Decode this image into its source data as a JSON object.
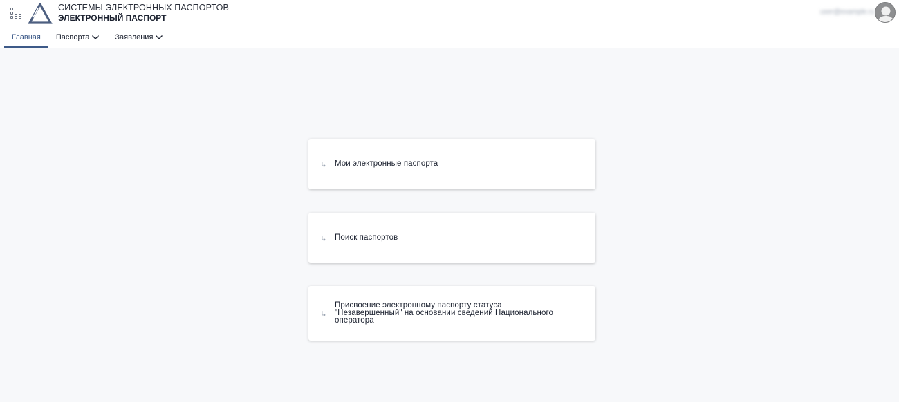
{
  "header": {
    "brand_line1": "СИСТЕМЫ ЭЛЕКТРОННЫХ ПАСПОРТОВ",
    "brand_line2": "ЭЛЕКТРОННЫЙ ПАСПОРТ",
    "apps_icon": "grid-icon",
    "logo_icon": "triangle-logo",
    "user_name": "user@example.ru",
    "colors": {
      "accent": "#3d5a88",
      "logo": "#4d5f80"
    }
  },
  "nav": {
    "items": [
      {
        "label": "Главная",
        "active": true
      },
      {
        "label": "Паспорта",
        "dropdown": true
      },
      {
        "label": "Заявления",
        "dropdown": true
      }
    ]
  },
  "cards": [
    {
      "label": "Мои электронные паспорта",
      "icon": "arrow-return-icon"
    },
    {
      "label": "Поиск паспортов",
      "icon": "arrow-return-icon"
    },
    {
      "label": "Присвоение электронному паспорту статуса \"Незавершенный\" на основании сведений Национального оператора",
      "icon": "arrow-return-icon"
    }
  ],
  "icons": {
    "card_arrow": "↳"
  }
}
